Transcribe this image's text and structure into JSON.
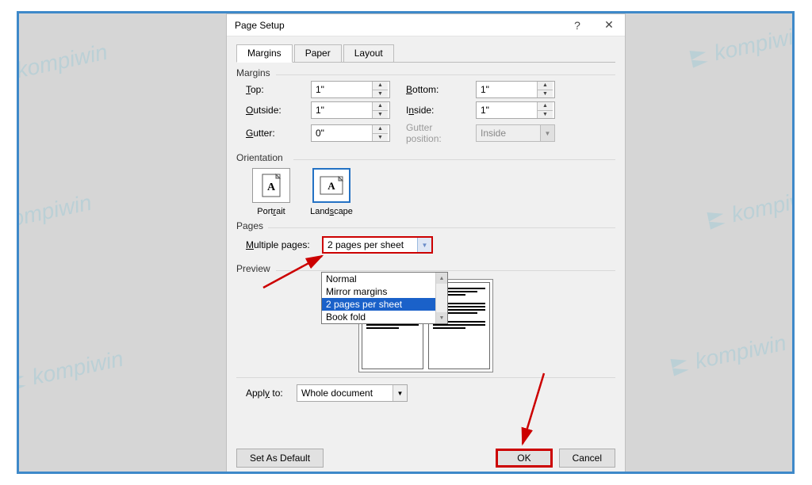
{
  "watermark": "kompiwin",
  "dialog": {
    "title": "Page Setup",
    "help": "?",
    "close": "✕",
    "tabs": [
      "Margins",
      "Paper",
      "Layout"
    ],
    "active_tab": 0,
    "sections": {
      "margins": "Margins",
      "orientation": "Orientation",
      "pages": "Pages",
      "preview": "Preview"
    },
    "margins": {
      "top_label": "Top:",
      "top_value": "1\"",
      "bottom_label": "Bottom:",
      "bottom_value": "1\"",
      "outside_label": "Outside:",
      "outside_value": "1\"",
      "inside_label": "Inside:",
      "inside_value": "1\"",
      "gutter_label": "Gutter:",
      "gutter_value": "0\"",
      "gutter_pos_label": "Gutter position:",
      "gutter_pos_value": "Inside"
    },
    "orientation": {
      "portrait": "Portrait",
      "landscape": "Landscape",
      "selected": "landscape"
    },
    "pages": {
      "multiple_label": "Multiple pages:",
      "selected": "2 pages per sheet",
      "options": [
        "Normal",
        "Mirror margins",
        "2 pages per sheet",
        "Book fold"
      ],
      "highlight_index": 2
    },
    "apply_to_label": "Apply to:",
    "apply_to_value": "Whole document",
    "buttons": {
      "set_default": "Set As Default",
      "ok": "OK",
      "cancel": "Cancel"
    }
  }
}
